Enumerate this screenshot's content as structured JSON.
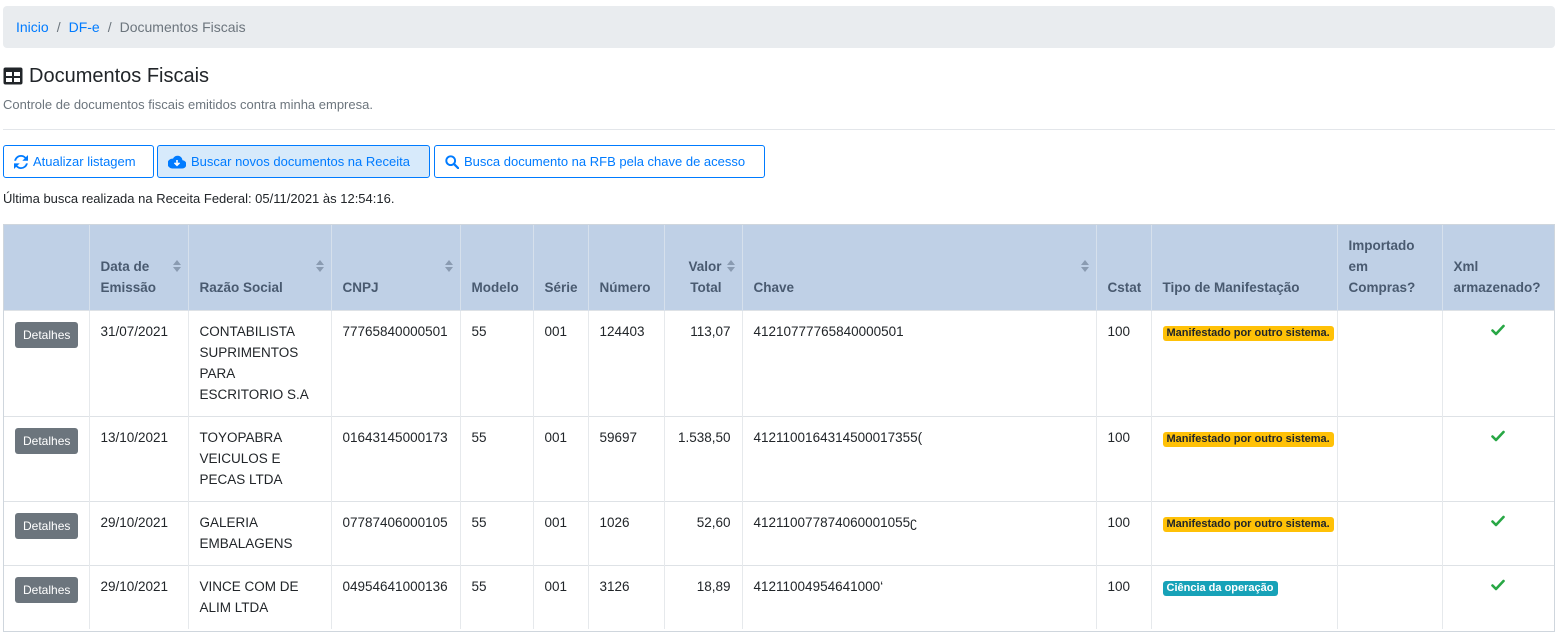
{
  "breadcrumb": {
    "items": [
      "Inicio",
      "DF-e"
    ],
    "active": "Documentos Fiscais",
    "separator": "/"
  },
  "page": {
    "title": "Documentos Fiscais",
    "subtitle": "Controle de documentos fiscais emitidos contra minha empresa.",
    "title_icon": "table-icon"
  },
  "toolbar": {
    "refresh_label": "Atualizar listagem",
    "fetch_label": "Buscar novos documentos na Receita",
    "search_key_label": "Busca documento na RFB pela chave de acesso"
  },
  "last_search": "Última busca realizada na Receita Federal: 05/11/2021 às 12:54:16.",
  "table": {
    "headers": {
      "actions": "",
      "date": "Data de Emissão",
      "razao": "Razão Social",
      "cnpj": "CNPJ",
      "modelo": "Modelo",
      "serie": "Série",
      "numero": "Número",
      "valor": "Valor Total",
      "chave": "Chave",
      "cstat": "Cstat",
      "tipo": "Tipo de Manifestação",
      "importado": "Importado em Compras?",
      "xml": "Xml armazenado?"
    },
    "rows": [
      {
        "action": "Detalhes",
        "date": "31/07/2021",
        "razao": "CONTABILISTA SUPRIMENTOS PARA ESCRITORIO S.A",
        "cnpj": "77765840000501",
        "modelo": "55",
        "serie": "001",
        "numero": "124403",
        "valor": "113,07",
        "chave": "41210777765840000501",
        "cstat": "100",
        "tipo": "Manifestado por outro sistema.",
        "tipo_style": "warning",
        "importado": "",
        "xml": "check-icon"
      },
      {
        "action": "Detalhes",
        "date": "13/10/2021",
        "razao": "TOYOPABRA VEICULOS E PECAS LTDA",
        "cnpj": "01643145000173",
        "modelo": "55",
        "serie": "001",
        "numero": "59697",
        "valor": "1.538,50",
        "chave": "4121100164314500017355(",
        "cstat": "100",
        "tipo": "Manifestado por outro sistema.",
        "tipo_style": "warning",
        "importado": "",
        "xml": "check-icon"
      },
      {
        "action": "Detalhes",
        "date": "29/10/2021",
        "razao": "GALERIA EMBALAGENS",
        "cnpj": "07787406000105",
        "modelo": "55",
        "serie": "001",
        "numero": "1026",
        "valor": "52,60",
        "chave": "412110077874060001055ʗ",
        "cstat": "100",
        "tipo": "Manifestado por outro sistema.",
        "tipo_style": "warning",
        "importado": "",
        "xml": "check-icon"
      },
      {
        "action": "Detalhes",
        "date": "29/10/2021",
        "razao": "VINCE COM DE ALIM LTDA",
        "cnpj": "04954641000136",
        "modelo": "55",
        "serie": "001",
        "numero": "3126",
        "valor": "18,89",
        "chave": "41211004954641000‘",
        "cstat": "100",
        "tipo": "Ciência da operação",
        "tipo_style": "info",
        "importado": "",
        "xml": "check-icon"
      }
    ]
  },
  "colors": {
    "primary": "#007bff",
    "header_bg": "#bfd0e6",
    "badge_warning": "#ffc107",
    "badge_info": "#17a2b8",
    "check": "#28a745",
    "details_button": "#6c757d"
  }
}
